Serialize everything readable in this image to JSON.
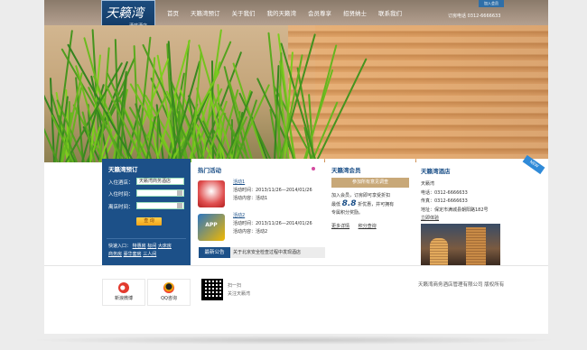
{
  "header": {
    "logo_cn": "天籁湾",
    "logo_sub": "酒航酒店",
    "logo_en": "TIANLAI BAY BUSINESS HOTEL",
    "nav": [
      "首页",
      "天籁湾预订",
      "关于我们",
      "我的天籁湾",
      "会员尊享",
      "招贤纳士",
      "联系我们"
    ],
    "phone": "订房电话 0312-6666633",
    "top_button": "加入会员"
  },
  "login": {
    "title": "天籁湾预订",
    "hotel_label": "入住酒店：",
    "hotel_value": "天籁湾商务酒店",
    "checkin_label": "入住时间：",
    "checkout_label": "离店时间：",
    "submit": "查 询",
    "quick_label": "快速入口：",
    "quick_links": [
      "特惠房",
      "标间",
      "大床房",
      "商务房",
      "豪华套房",
      "三人间"
    ]
  },
  "activities": {
    "title": "热门活动",
    "items": [
      {
        "link": "活动1",
        "time": "活动时间：2013/11/26—2014/01/26",
        "content": "活动内容：活动1"
      },
      {
        "link": "活动2",
        "time": "活动时间：2013/11/26—2014/01/26",
        "content": "活动内容：活动2"
      }
    ],
    "app_text": "APP",
    "news_tag": "最新公告",
    "news_text": "关于北京安全检查过程中发现酒店"
  },
  "member": {
    "title": "天籁湾会员",
    "button": "参加所有意见调查",
    "line1": "加入会员，订房即可享受折扣",
    "line2_pre": "最低",
    "line2_big": "8.8",
    "line2_post": "折优惠，并可拥有",
    "line3": "专属积分奖励。",
    "links": [
      "更多详情",
      "积分查询"
    ]
  },
  "hotel": {
    "title": "天籁湾酒店",
    "ribbon": "NEW",
    "name": "天籁湾",
    "tel": "电话：0312-6666633",
    "fax": "传真：0312-6666633",
    "address": "地址：保定市满城县朝阳路182号",
    "link": "立即体验"
  },
  "footer": {
    "weibo": "新浪微博",
    "qq": "QQ咨询",
    "scan1": "扫一扫",
    "scan2": "关注天籁湾",
    "copyright": "天籁湾商务酒店管理有限公司 版权所有"
  }
}
